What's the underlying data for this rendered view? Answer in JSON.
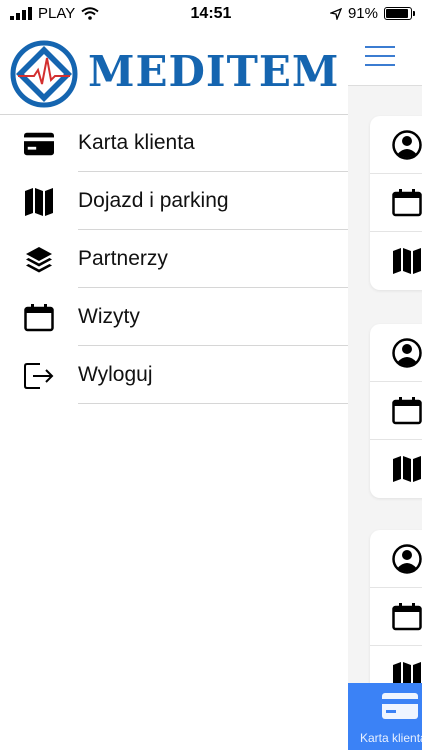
{
  "status_bar": {
    "carrier": "PLAY",
    "time": "14:51",
    "battery_percent": "91%",
    "battery_level": 0.91
  },
  "drawer": {
    "logo_text": "MEDITEM",
    "items": [
      {
        "label": "Karta klienta",
        "icon": "credit-card-icon"
      },
      {
        "label": "Dojazd i parking",
        "icon": "map-icon"
      },
      {
        "label": "Partnerzy",
        "icon": "layers-icon"
      },
      {
        "label": "Wizyty",
        "icon": "calendar-icon"
      },
      {
        "label": "Wyloguj",
        "icon": "logout-icon"
      }
    ]
  },
  "main": {
    "tab_label": "Karta klienta"
  },
  "colors": {
    "brand": "#1565b0",
    "accent": "#3b82f6",
    "hamburger": "#3b7cd1"
  }
}
